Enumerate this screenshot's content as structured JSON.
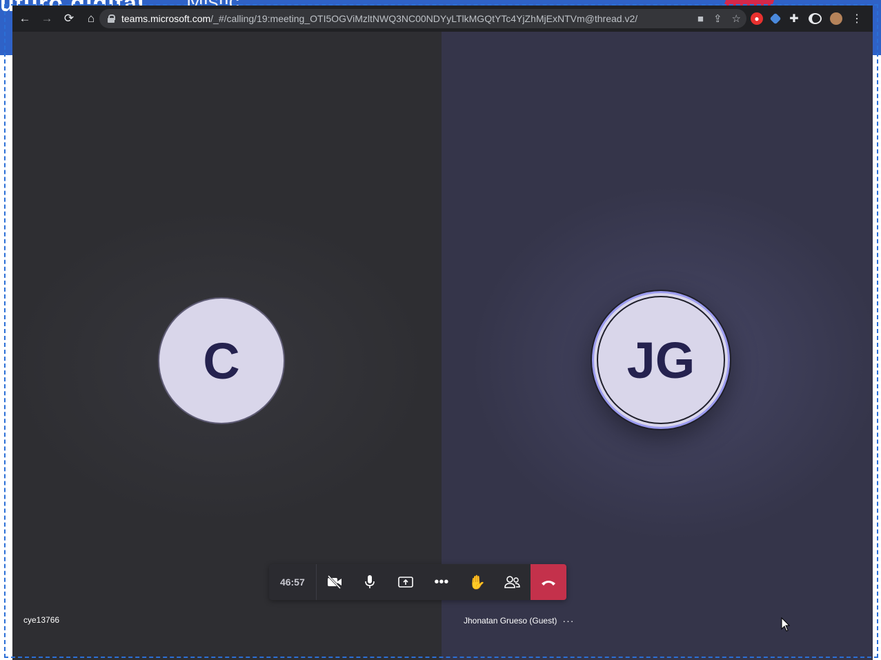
{
  "background": {
    "slide_text_left": "uturo digital",
    "slide_text_right": "Mistic",
    "slide_letter": "d"
  },
  "browser": {
    "url_host": "teams.microsoft.com",
    "url_path": "/_#/calling/19:meeting_OTI5OGViMzltNWQ3NC00NDYyLTlkMGQtYTc4YjZhMjExNTVm@thread.v2/"
  },
  "meeting": {
    "participants": [
      {
        "initials": "C",
        "name": "cye13766"
      },
      {
        "initials": "JG",
        "name": "Jhonatan Grueso (Guest)",
        "more_label": "···"
      }
    ],
    "controls": {
      "timer": "46:57",
      "more_label": "•••"
    }
  },
  "colors": {
    "accent": "#9c9cf0",
    "hangup": "#c4314b",
    "avatar_bg": "#d9d6ea",
    "avatar_text": "#25224f"
  }
}
